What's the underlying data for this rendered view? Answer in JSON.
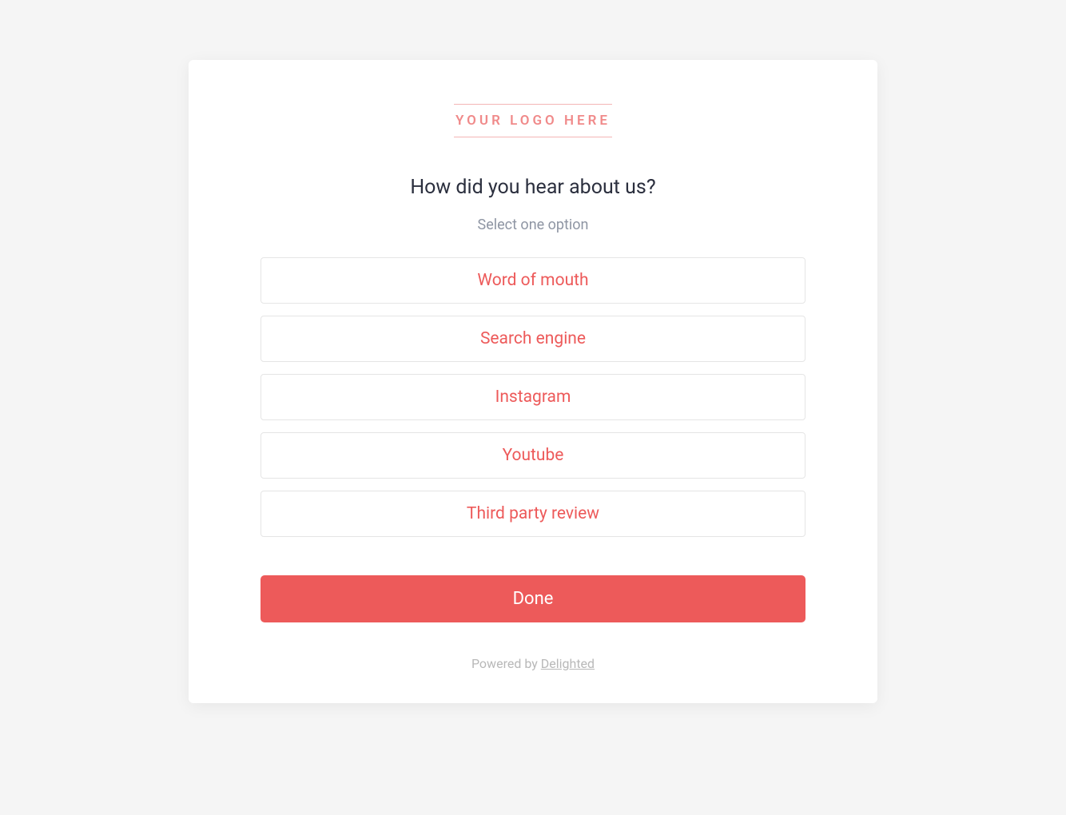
{
  "logo": {
    "text": "YOUR LOGO HERE"
  },
  "survey": {
    "question": "How did you hear about us?",
    "instruction": "Select one option",
    "options": [
      "Word of mouth",
      "Search engine",
      "Instagram",
      "Youtube",
      "Third party review"
    ],
    "done_label": "Done"
  },
  "footer": {
    "powered_by_prefix": "Powered by ",
    "powered_by_brand": "Delighted"
  },
  "colors": {
    "accent": "#ed5a5a",
    "card_bg": "#ffffff",
    "page_bg": "#f5f5f5"
  }
}
